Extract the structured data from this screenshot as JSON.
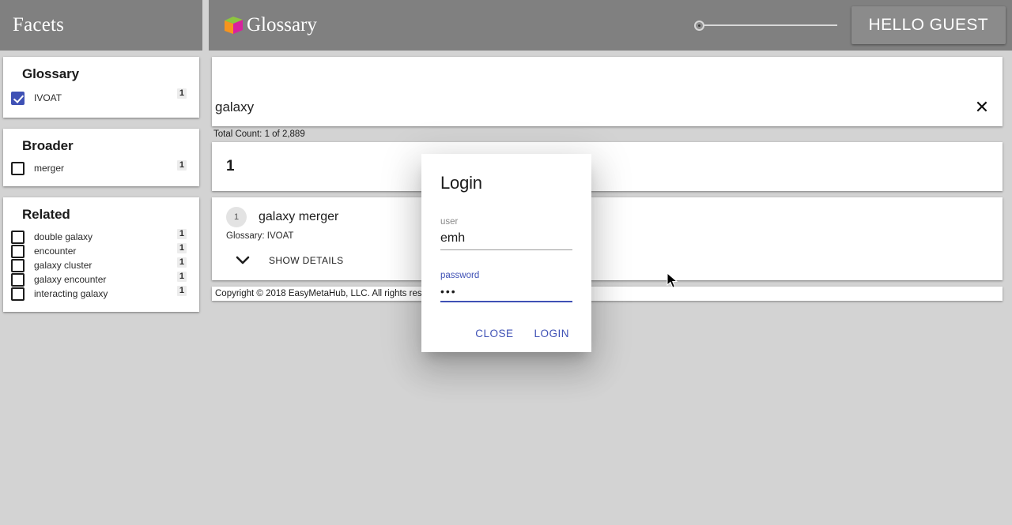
{
  "facets": {
    "header_title": "Facets",
    "groups": [
      {
        "title": "Glossary",
        "items": [
          {
            "label": "IVOAT",
            "count": "1",
            "checked": true
          }
        ]
      },
      {
        "title": "Broader",
        "items": [
          {
            "label": "merger",
            "count": "1",
            "checked": false
          }
        ]
      },
      {
        "title": "Related",
        "items": [
          {
            "label": "double galaxy",
            "count": "1",
            "checked": false
          },
          {
            "label": "encounter",
            "count": "1",
            "checked": false
          },
          {
            "label": "galaxy cluster",
            "count": "1",
            "checked": false
          },
          {
            "label": "galaxy encounter",
            "count": "1",
            "checked": false
          },
          {
            "label": "interacting galaxy",
            "count": "1",
            "checked": false
          }
        ]
      }
    ]
  },
  "appbar": {
    "brand_name": "Glossary",
    "logo_icon": "cube-icon",
    "slider_value": 0,
    "guest_button_label": "HELLO GUEST"
  },
  "search": {
    "value": "galaxy",
    "placeholder": "",
    "clear_icon": "close-icon"
  },
  "results": {
    "total_count_text": "Total Count: 1 of 2,889",
    "count_number": "1",
    "items": [
      {
        "badge": "1",
        "title": "galaxy merger",
        "subtitle": "Glossary: IVOAT",
        "expander_label": "SHOW DETAILS",
        "expander_icon": "chevron-down-icon"
      }
    ]
  },
  "footer": {
    "copyright": "Copyright © 2018 EasyMetaHub, LLC. All rights reserved."
  },
  "dialog": {
    "title": "Login",
    "user_label": "user",
    "user_value": "emh",
    "password_label": "password",
    "password_value": "•••",
    "close_label": "CLOSE",
    "login_label": "LOGIN"
  },
  "colors": {
    "accent": "#3f51b5",
    "appbar": "#808080",
    "page_bg": "#d3d3d3",
    "logo_top": "#8dc63f",
    "logo_left": "#f7941e",
    "logo_right": "#d9219e"
  }
}
